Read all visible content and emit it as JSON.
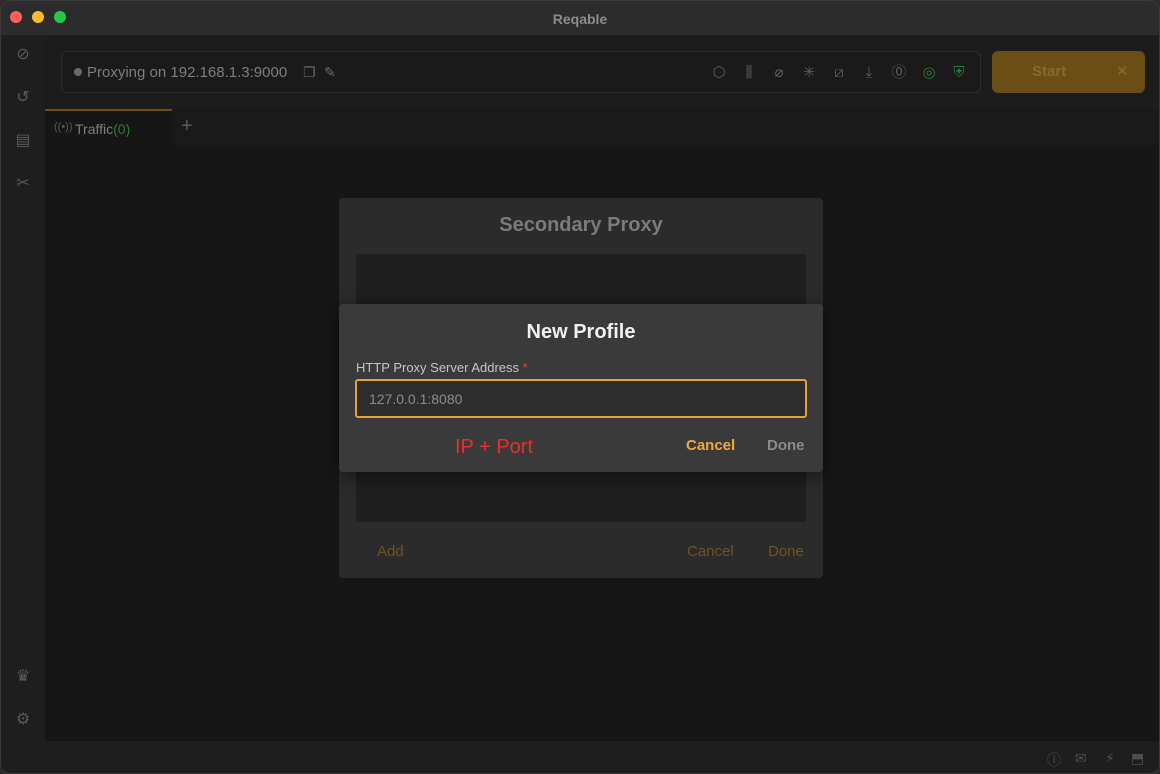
{
  "window": {
    "title": "Reqable"
  },
  "rail": {
    "icons": [
      "capture-icon",
      "history-icon",
      "collections-icon",
      "tools-icon",
      "crown-icon",
      "settings-icon",
      "sidebar-toggle-icon"
    ]
  },
  "toolbar": {
    "proxy_status": "Proxying on 192.168.1.3:9000",
    "start_label": "Start",
    "icons": [
      "ssl-icon",
      "breakpoint-icon",
      "script-disable-icon",
      "debug-icon",
      "block-icon",
      "download-icon",
      "timer-icon",
      "network-icon",
      "shield-icon"
    ]
  },
  "tabs": [
    {
      "label": "Traffic",
      "count": "(0)"
    }
  ],
  "secondary_proxy_dialog": {
    "title": "Secondary Proxy",
    "add_label": "Add",
    "cancel_label": "Cancel",
    "done_label": "Done"
  },
  "new_profile_dialog": {
    "title": "New Profile",
    "field_label": "HTTP Proxy Server Address",
    "required_mark": "*",
    "placeholder": "127.0.0.1:8080",
    "annotation": "IP + Port",
    "cancel_label": "Cancel",
    "done_label": "Done"
  },
  "colors": {
    "accent": "#e3a233",
    "required": "#e0423a",
    "annotation": "#e5302c",
    "traffic_count": "#2f7a3a"
  }
}
